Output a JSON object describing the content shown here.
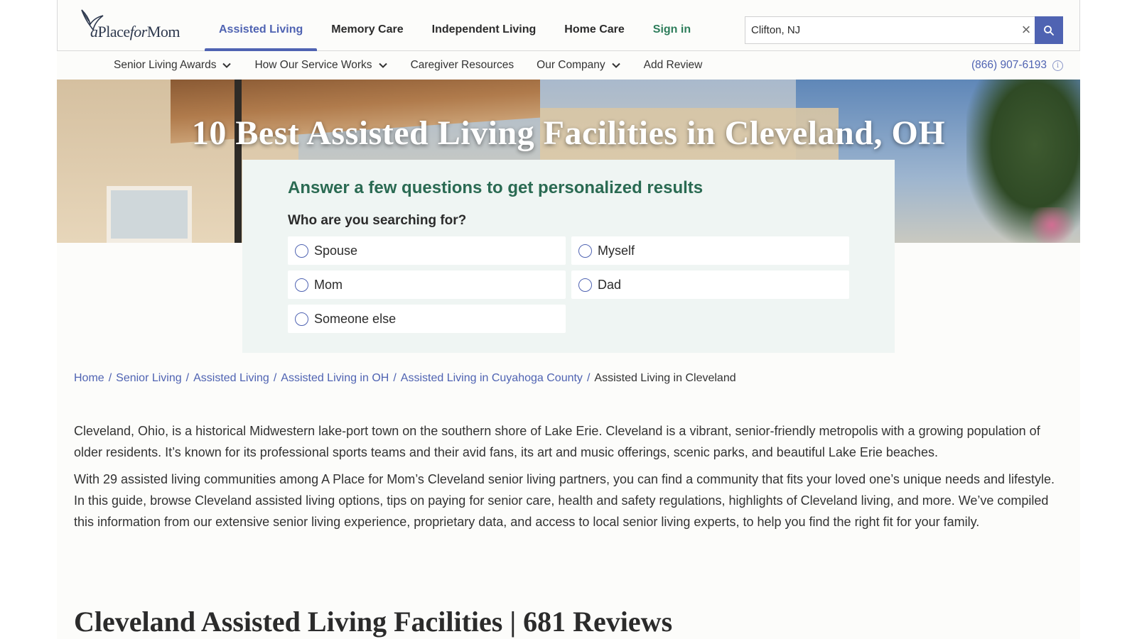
{
  "header": {
    "logo_text_a": "a",
    "logo_text_place": "Place",
    "logo_text_for": "for",
    "logo_text_mom": "Mom",
    "nav": [
      {
        "label": "Assisted Living"
      },
      {
        "label": "Memory Care"
      },
      {
        "label": "Independent Living"
      },
      {
        "label": "Home Care"
      },
      {
        "label": "Sign in"
      }
    ],
    "active_nav": "Assisted Living",
    "search": {
      "value": "Clifton, NJ",
      "clear_symbol": "×"
    }
  },
  "subnav": {
    "items": [
      {
        "label": "Senior Living Awards"
      },
      {
        "label": "How Our Service Works"
      },
      {
        "label": "Caregiver Resources"
      },
      {
        "label": "Our Company"
      },
      {
        "label": "Add Review"
      }
    ],
    "phone": "(866) 907-6193",
    "info_symbol": "i"
  },
  "hero": {
    "title": "10 Best Assisted Living Facilities in Cleveland, OH"
  },
  "quiz": {
    "heading": "Answer a few questions to get personalized results",
    "question": "Who are you searching for?",
    "options": [
      {
        "label": "Spouse"
      },
      {
        "label": "Myself"
      },
      {
        "label": "Mom"
      },
      {
        "label": "Dad"
      },
      {
        "label": "Someone else"
      }
    ]
  },
  "breadcrumb": {
    "items": [
      {
        "label": "Home"
      },
      {
        "label": "Senior Living"
      },
      {
        "label": "Assisted Living"
      },
      {
        "label": "Assisted Living in OH"
      },
      {
        "label": "Assisted Living in Cuyahoga County"
      }
    ],
    "separator": "/",
    "current": "Assisted Living in Cleveland"
  },
  "intro": {
    "p1": "Cleveland, Ohio, is a historical Midwestern lake-port town on the southern shore of Lake Erie. Cleveland is a vibrant, senior-friendly metropolis with a growing population of older residents. It’s known for its professional sports teams and their avid fans, its art and music offerings, scenic parks, and beautiful Lake Erie beaches.",
    "p2": "With 29 assisted living communities among A Place for Mom’s Cleveland senior living partners, you can find a community that fits your loved one’s unique needs and lifestyle. In this guide, browse Cleveland assisted living options, tips on paying for senior care, health and safety regulations, highlights of Cleveland living, and more. We’ve compiled this information from our extensive senior living experience, proprietary data, and access to local senior living experts, to help you find the right fit for your family."
  },
  "section": {
    "title": "Cleveland Assisted Living Facilities | 681 Reviews"
  },
  "colors": {
    "accent": "#4f63b2",
    "green": "#2a6a52",
    "signin": "#2e7d5b"
  }
}
